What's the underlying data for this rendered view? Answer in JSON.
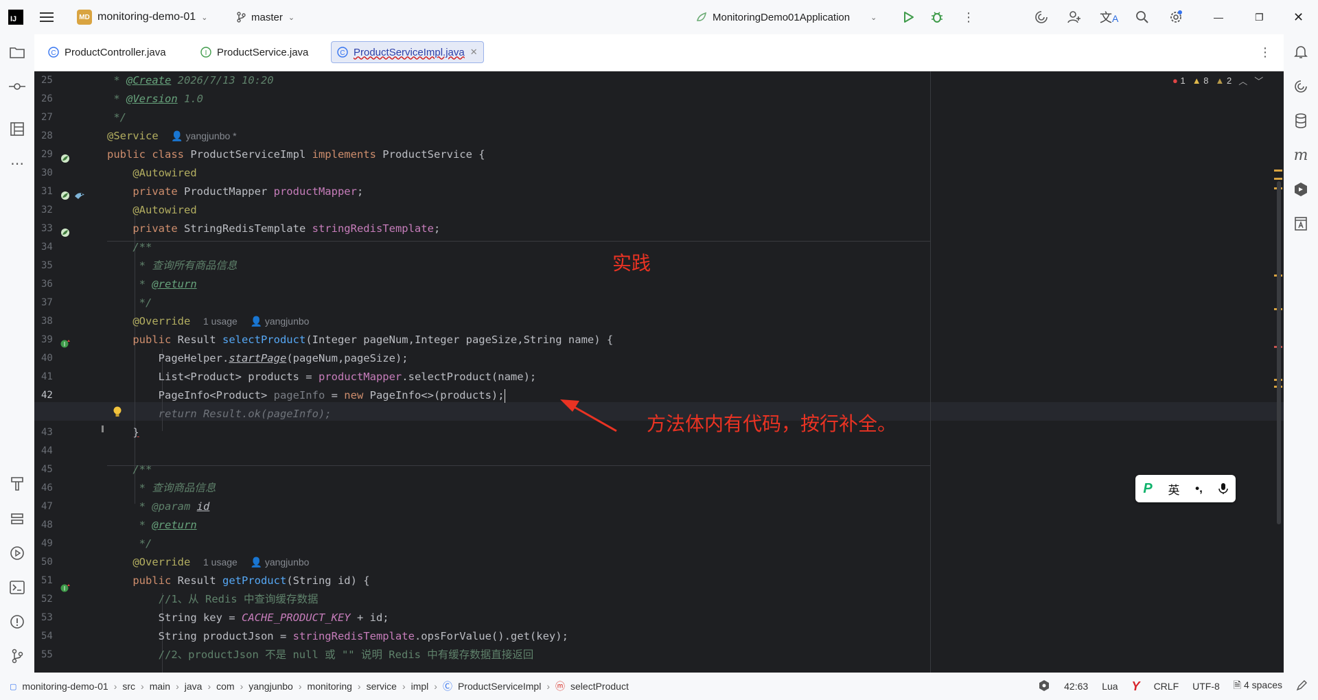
{
  "titlebar": {
    "logo": "IJ",
    "project_badge": "MD",
    "project_name": "monitoring-demo-01",
    "branch": "master",
    "run_config": "MonitoringDemo01Application"
  },
  "tabs": [
    {
      "label": "ProductController.java",
      "icon": "C"
    },
    {
      "label": "ProductService.java",
      "icon": "I"
    },
    {
      "label": "ProductServiceImpl.java",
      "icon": "C",
      "active": true
    }
  ],
  "inspections": {
    "errors": "1",
    "warnings": "8",
    "weak": "2"
  },
  "line_numbers": [
    "25",
    "26",
    "27",
    "28",
    "29",
    "30",
    "31",
    "32",
    "33",
    "34",
    "35",
    "36",
    "37",
    "38",
    "39",
    "40",
    "41",
    "42",
    "43",
    "44",
    "45",
    "46",
    "47",
    "48",
    "49",
    "50",
    "51",
    "52",
    "53",
    "54",
    "55"
  ],
  "code": {
    "l25_tag": "@Create",
    "l25_val": " 2026/7/13 10:20",
    "l26_tag": "@Version",
    "l26_val": " 1.0",
    "l27": " */",
    "l28_ann": "@Service",
    "l28_hint": "yangjunbo *",
    "l29_kw1": "public class ",
    "l29_name": "ProductServiceImpl ",
    "l29_kw2": "implements ",
    "l29_iface": "ProductService {",
    "l30": "@Autowired",
    "l31_kw": "private ",
    "l31_type": "ProductMapper ",
    "l31_fld": "productMapper",
    "l31_end": ";",
    "l32": "@Autowired",
    "l33_kw": "private ",
    "l33_type": "StringRedisTemplate ",
    "l33_fld": "stringRedisTemplate",
    "l33_end": ";",
    "l34": "/**",
    "l35": " * 查询所有商品信息",
    "l36_tag": "@return",
    "l37": " */",
    "l38_ann": "@Override",
    "l38_usage": "1 usage",
    "l38_author": "yangjunbo",
    "l39_kw": "public ",
    "l39_type": "Result ",
    "l39_fn": "selectProduct",
    "l39_params": "(Integer pageNum,Integer pageSize,String name) {",
    "l40_a": "PageHelper.",
    "l40_fn": "startPage",
    "l40_b": "(pageNum,pageSize);",
    "l41_a": "List<Product> products = ",
    "l41_fld": "productMapper",
    "l41_b": ".selectProduct(name);",
    "l42_a": "PageInfo<Product> ",
    "l42_var": "pageInfo",
    "l42_b": " = ",
    "l42_kw": "new ",
    "l42_c": "PageInfo<>(products);",
    "l42_5": "return Result.ok(pageInfo);",
    "l43": "}",
    "l45": "/**",
    "l46": " * 查询商品信息",
    "l47_tag": "@param",
    "l47_val": "id",
    "l48_tag": "@return",
    "l49": " */",
    "l50_ann": "@Override",
    "l50_usage": "1 usage",
    "l50_author": "yangjunbo",
    "l51_kw": "public ",
    "l51_type": "Result ",
    "l51_fn": "getProduct",
    "l51_params": "(String id) {",
    "l52": "//1、从 Redis 中查询缓存数据",
    "l53_a": "String key = ",
    "l53_const": "CACHE_PRODUCT_KEY",
    "l53_b": " + id;",
    "l54_a": "String productJson = ",
    "l54_fld": "stringRedisTemplate",
    "l54_b": ".opsForValue().get(key);",
    "l55": "//2、productJson 不是 null 或 \"\" 说明 Redis 中有缓存数据直接返回"
  },
  "annotations": {
    "practice": "实践",
    "note": "方法体内有代码，按行补全。"
  },
  "ime": {
    "lang": "英",
    "punct": "•,"
  },
  "breadcrumb": [
    "monitoring-demo-01",
    "src",
    "main",
    "java",
    "com",
    "yangjunbo",
    "monitoring",
    "service",
    "impl",
    "ProductServiceImpl",
    "selectProduct"
  ],
  "status": {
    "position": "42:63",
    "language": "Lua",
    "line_sep": "CRLF",
    "encoding": "UTF-8",
    "indent": "4 spaces"
  }
}
